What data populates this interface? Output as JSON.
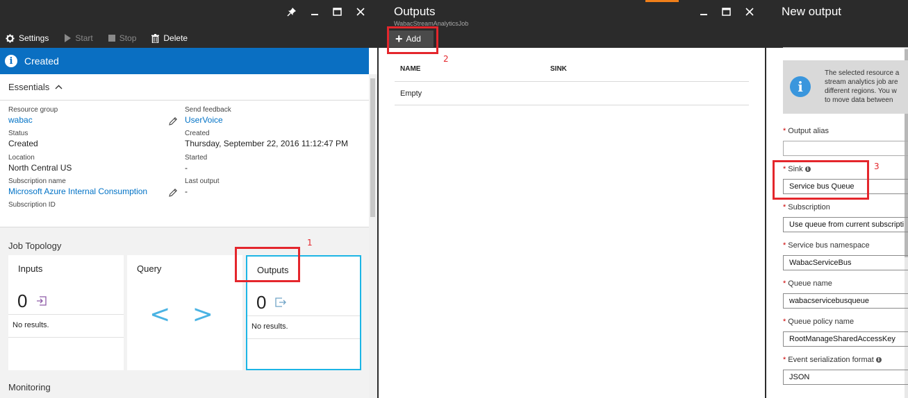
{
  "blade1": {
    "commands": {
      "settings": "Settings",
      "start": "Start",
      "stop": "Stop",
      "delete": "Delete"
    },
    "status": "Created",
    "essentials_label": "Essentials",
    "fields": {
      "resource_group_label": "Resource group",
      "resource_group_value": "wabac",
      "status_label": "Status",
      "status_value": "Created",
      "location_label": "Location",
      "location_value": "North Central US",
      "subscription_name_label": "Subscription name",
      "subscription_name_value": "Microsoft Azure Internal Consumption",
      "subscription_id_label": "Subscription ID",
      "send_feedback_label": "Send feedback",
      "send_feedback_value": "UserVoice",
      "created_label": "Created",
      "created_value": "Thursday, September 22, 2016 11:12:47 PM",
      "started_label": "Started",
      "started_value": "-",
      "last_output_label": "Last output",
      "last_output_value": "-"
    },
    "job_topology_label": "Job Topology",
    "tiles": {
      "inputs": {
        "name": "Inputs",
        "count": "0",
        "result": "No results."
      },
      "query": {
        "name": "Query",
        "glyph": "< >"
      },
      "outputs": {
        "name": "Outputs",
        "count": "0",
        "result": "No results."
      }
    },
    "monitoring_label": "Monitoring"
  },
  "blade2": {
    "title": "Outputs",
    "subtitle": "WabacStreamAnalyticsJob",
    "add_label": "Add",
    "columns": [
      "NAME",
      "SINK"
    ],
    "empty_text": "Empty"
  },
  "blade3": {
    "title": "New output",
    "info_lines": [
      "The selected resource a",
      "stream analytics job are",
      "different regions. You w",
      "to move data between"
    ],
    "fields": {
      "output_alias_label": "Output alias",
      "output_alias_value": "",
      "sink_label": "Sink",
      "sink_value": "Service bus Queue",
      "subscription_label": "Subscription",
      "subscription_value": "Use queue from current subscripti",
      "namespace_label": "Service bus namespace",
      "namespace_value": "WabacServiceBus",
      "queue_name_label": "Queue name",
      "queue_name_value": "wabacservicebusqueue",
      "queue_policy_label": "Queue policy name",
      "queue_policy_value": "RootManageSharedAccessKey",
      "event_format_label": "Event serialization format",
      "event_format_value": "JSON"
    }
  },
  "annotations": {
    "step1": "1",
    "step2": "2",
    "step3": "3"
  },
  "colors": {
    "chrome": "#2b2b2b",
    "status_bar": "#0a6fc2",
    "link": "#0072c6",
    "tile_highlight": "#1cb5e5",
    "annotation": "#e4262c",
    "accent_orange": "#f07f1a"
  }
}
